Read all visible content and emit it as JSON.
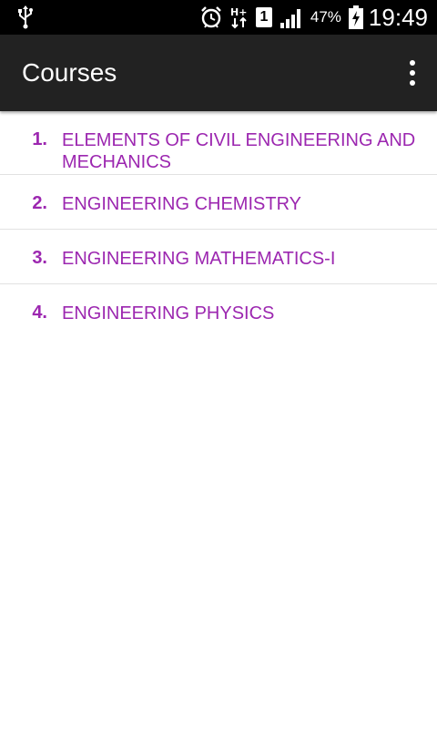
{
  "status_bar": {
    "icons": [
      "usb-icon",
      "alarm-icon",
      "network-hplus-icon",
      "sim-1-icon",
      "signal-icon",
      "battery-icon"
    ],
    "sim_label": "1",
    "network_label": "H+",
    "battery_percent": "47%",
    "time": "19:49"
  },
  "app_bar": {
    "title": "Courses",
    "menu_icon": "overflow-menu-icon"
  },
  "courses": [
    {
      "number": "1.",
      "title": "ELEMENTS OF CIVIL ENGINEERING AND MECHANICS"
    },
    {
      "number": "2.",
      "title": "ENGINEERING CHEMISTRY"
    },
    {
      "number": "3.",
      "title": "ENGINEERING MATHEMATICS-I"
    },
    {
      "number": "4.",
      "title": "ENGINEERING PHYSICS"
    }
  ],
  "colors": {
    "accent": "#9c27b0",
    "app_bar": "#222222",
    "status_bar": "#000000"
  }
}
